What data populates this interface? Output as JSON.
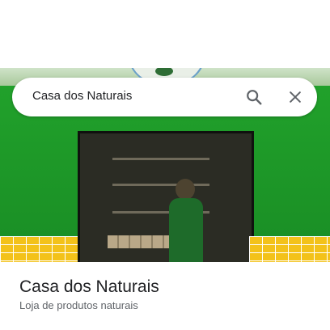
{
  "search": {
    "query": "Casa dos Naturais"
  },
  "place": {
    "name": "Casa dos Naturais",
    "category": "Loja de produtos naturais"
  },
  "icons": {
    "search": "search-icon",
    "close": "close-icon"
  },
  "colors": {
    "accent": "#1f9a2a",
    "text": "#202124",
    "secondary_text": "#5f6368",
    "tiles": "#f3c21a"
  }
}
